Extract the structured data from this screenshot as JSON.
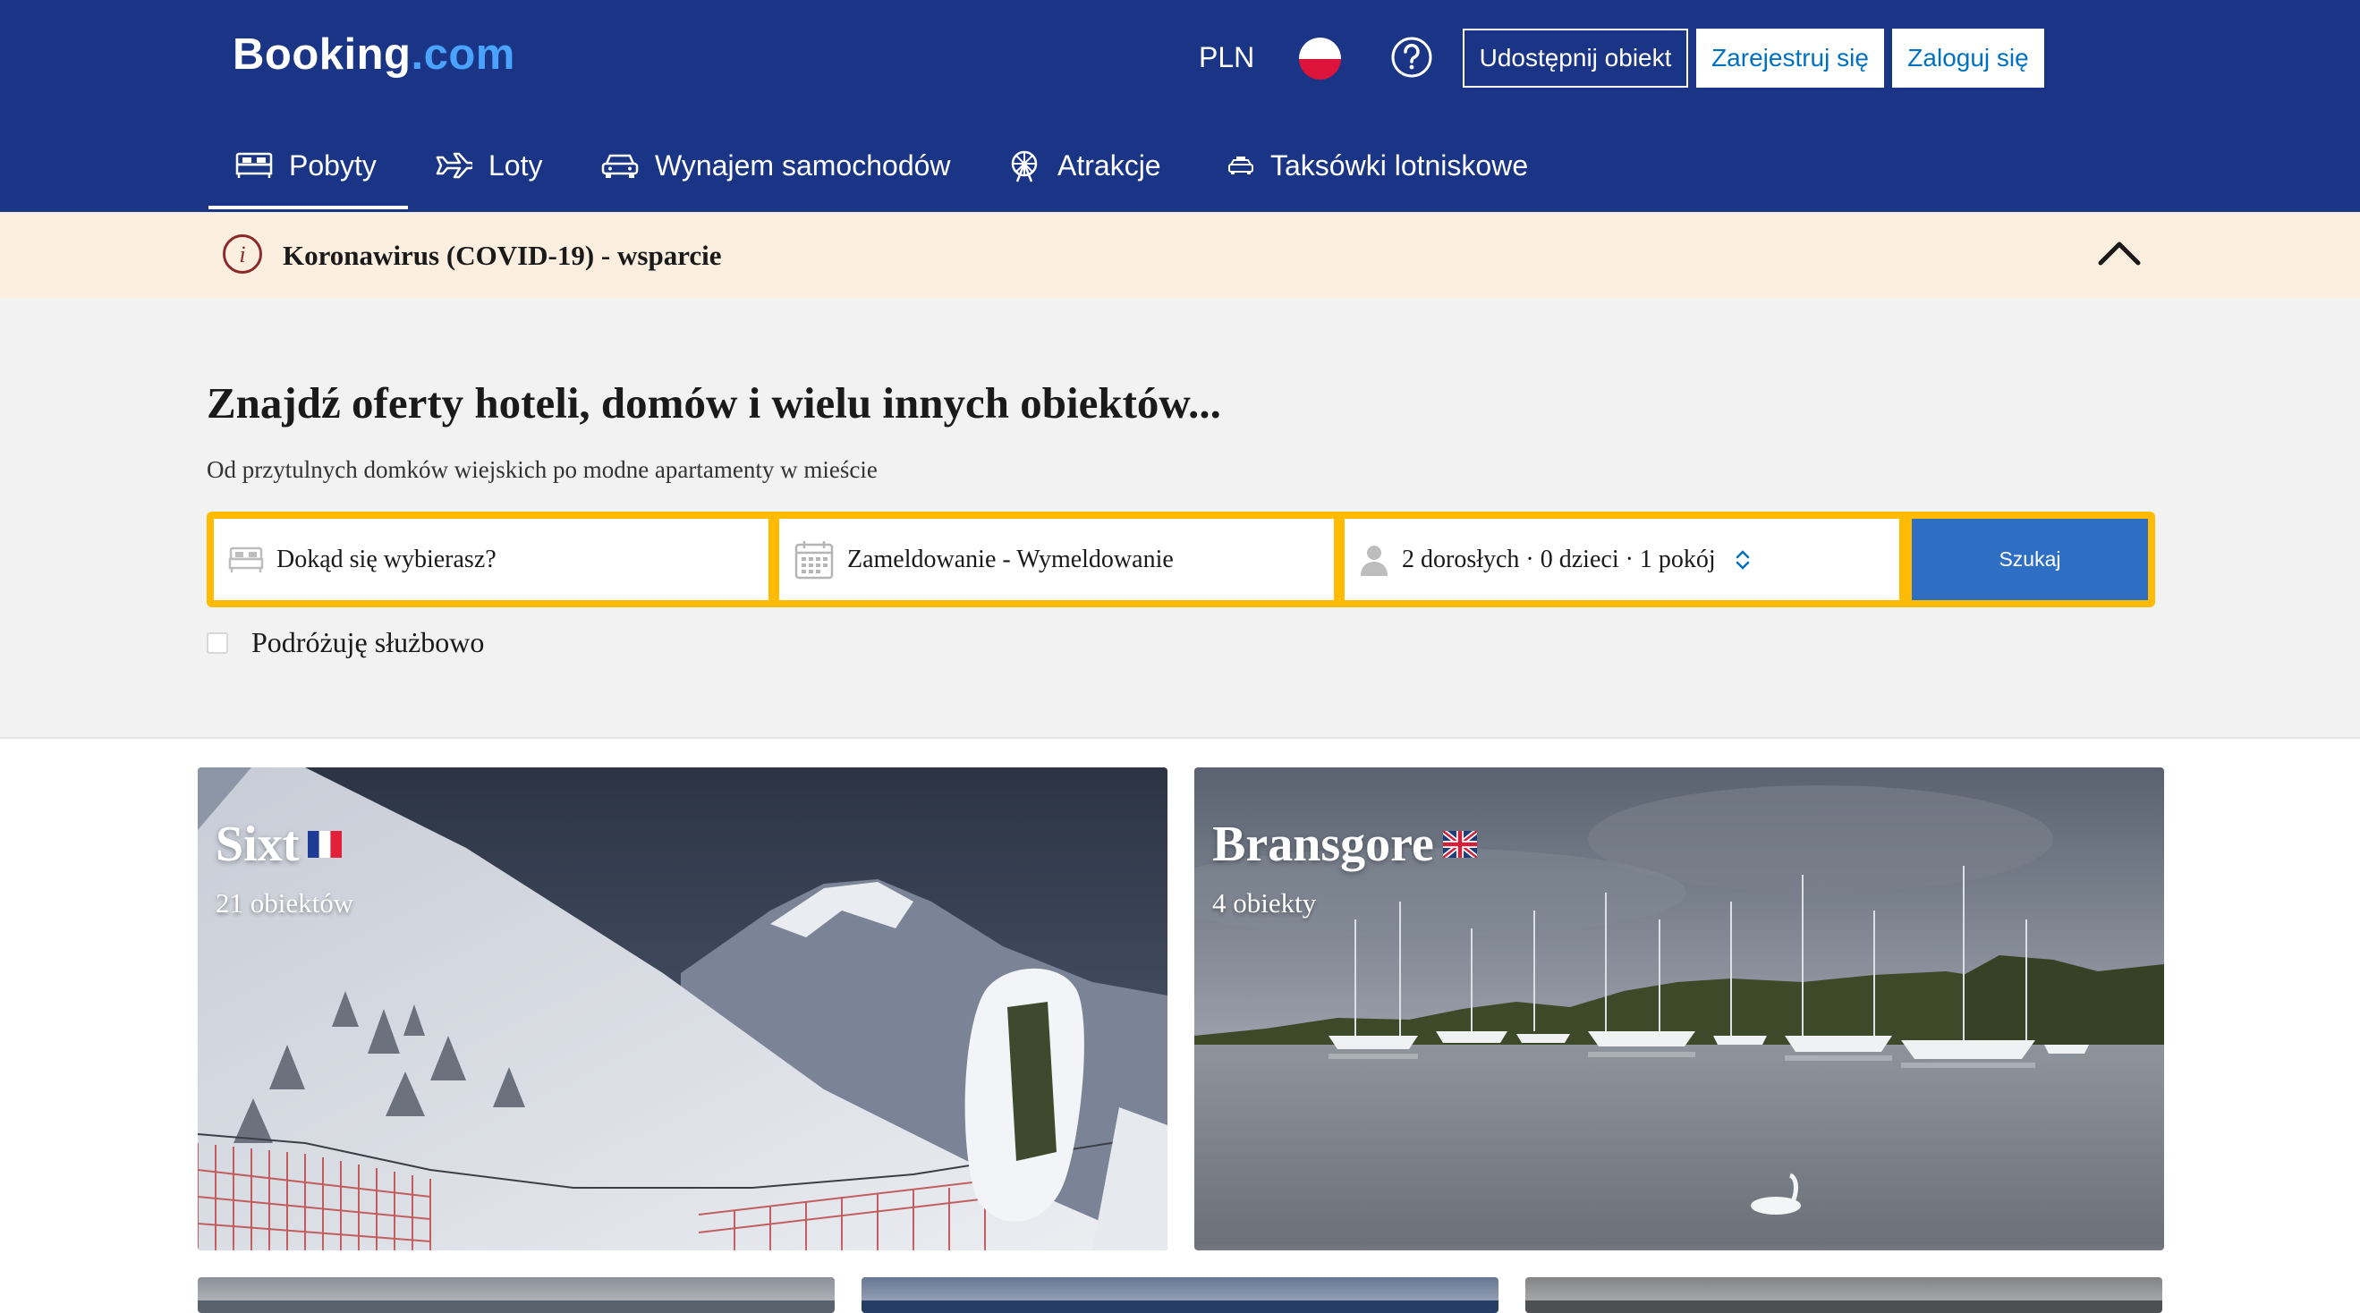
{
  "header": {
    "logo_main": "Booking",
    "logo_suffix": ".com",
    "currency": "PLN",
    "list_property": "Udostępnij obiekt",
    "register": "Zarejestruj się",
    "login": "Zaloguj się"
  },
  "nav": {
    "items": [
      {
        "label": "Pobyty",
        "icon": "bed-icon"
      },
      {
        "label": "Loty",
        "icon": "plane-icon"
      },
      {
        "label": "Wynajem samochodów",
        "icon": "car-icon"
      },
      {
        "label": "Atrakcje",
        "icon": "ferris-wheel-icon"
      },
      {
        "label": "Taksówki lotniskowe",
        "icon": "taxi-icon"
      }
    ]
  },
  "covid_banner": {
    "text": "Koronawirus (COVID-19) - wsparcie"
  },
  "hero": {
    "title": "Znajdź oferty hoteli, domów i wielu innych obiektów...",
    "subtitle": "Od przytulnych domków wiejskich po modne apartamenty w mieście"
  },
  "search": {
    "destination_placeholder": "Dokąd się wybierasz?",
    "dates_label": "Zameldowanie - Wymeldowanie",
    "guests_label": "2 dorosłych · 0 dzieci · 1 pokój",
    "button": "Szukaj",
    "business_trip_label": "Podróżuję służbowo"
  },
  "destinations": [
    {
      "name": "Sixt",
      "count": "21 obiektów",
      "flag": "fr"
    },
    {
      "name": "Bransgore",
      "count": "4 obiekty",
      "flag": "gb"
    }
  ],
  "colors": {
    "header_bg": "#1a3586",
    "accent_link": "#0071c2",
    "search_border": "#febb02",
    "search_button": "#2e6fc4",
    "covid_bg": "#fcefe0"
  }
}
